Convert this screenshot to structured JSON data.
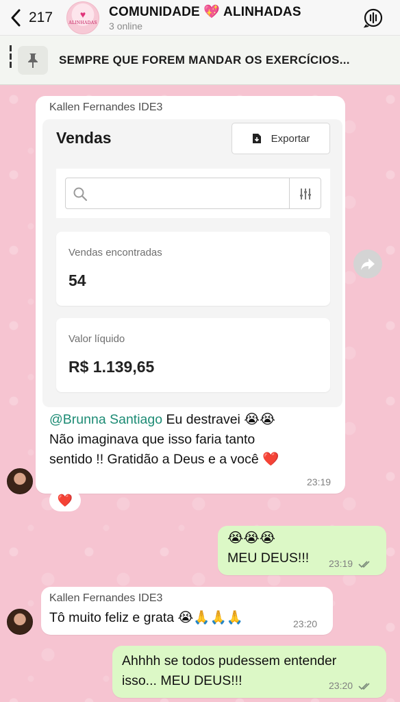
{
  "header": {
    "back_count": "217",
    "title": "COMUNIDADE 💖 ALINHADAS",
    "status": "3 online",
    "avatar_logo_text": "ALINHADAS"
  },
  "pinned": {
    "text": "SEMPRE QUE FOREM MANDAR OS EXERCÍCIOS..."
  },
  "messages": [
    {
      "sender": "Kallen Fernandes IDE3",
      "screenshot": {
        "title": "Vendas",
        "export_label": "Exportar",
        "search_placeholder": "",
        "stat1_label": "Vendas encontradas",
        "stat1_value": "54",
        "stat2_label": "Valor líquido",
        "stat2_value": "R$ 1.139,65"
      },
      "mention": "@Brunna Santiago",
      "text_line1": " Eu destravei 😭😭",
      "text_line2": "Não imaginava que isso faria tanto",
      "text_line3": "sentido !! Gratidão a Deus e a você ❤️",
      "time": "23:19",
      "reaction": "❤️"
    },
    {
      "emojis": "😭😭😭",
      "text": "MEU DEUS!!!",
      "time": "23:19"
    },
    {
      "sender": "Kallen Fernandes IDE3",
      "text": "Tô muito feliz e grata 😭🙏🙏🙏",
      "time": "23:20"
    },
    {
      "text_line1": "Ahhhh se todos pudessem entender",
      "text_line2": "isso... MEU DEUS!!!",
      "time": "23:20"
    }
  ],
  "colors": {
    "wallpaper": "#f6c4d1",
    "outgoing_bubble": "#dcf8c6",
    "mention": "#1c8b74"
  },
  "icons": [
    "chevron-left-icon",
    "audio-call-icon",
    "pin-icon",
    "download-file-icon",
    "search-icon",
    "filter-icon",
    "forward-icon",
    "double-check-icon"
  ]
}
